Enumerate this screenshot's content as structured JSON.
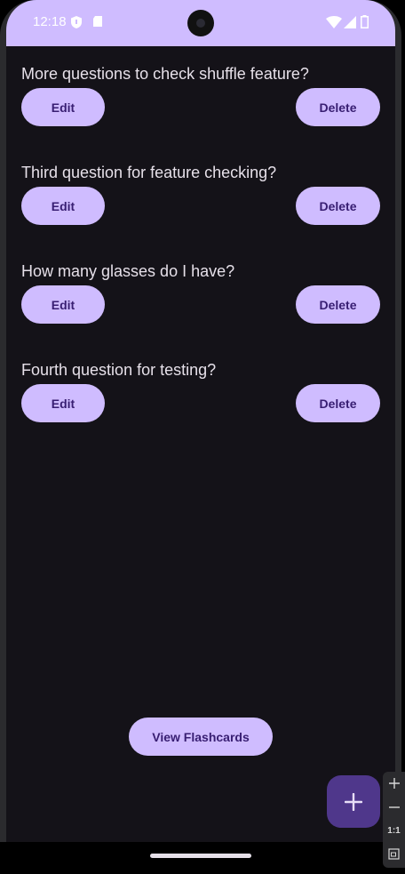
{
  "status_bar": {
    "time": "12:18"
  },
  "flashcards": [
    {
      "question": "More questions to check shuffle feature?",
      "edit_label": "Edit",
      "delete_label": "Delete"
    },
    {
      "question": "Third question for feature checking?",
      "edit_label": "Edit",
      "delete_label": "Delete"
    },
    {
      "question": "How many glasses do I have?",
      "edit_label": "Edit",
      "delete_label": "Delete"
    },
    {
      "question": "Fourth question for testing?",
      "edit_label": "Edit",
      "delete_label": "Delete"
    }
  ],
  "view_button_label": "View Flashcards",
  "fab_icon": "plus-icon",
  "emulator_toolbar": {
    "zoom_label": "1:1"
  },
  "colors": {
    "background": "#141218",
    "primary_container": "#cfbcff",
    "on_primary_container": "#381e72",
    "fab": "#4f378b",
    "text": "#e6e0e9"
  }
}
